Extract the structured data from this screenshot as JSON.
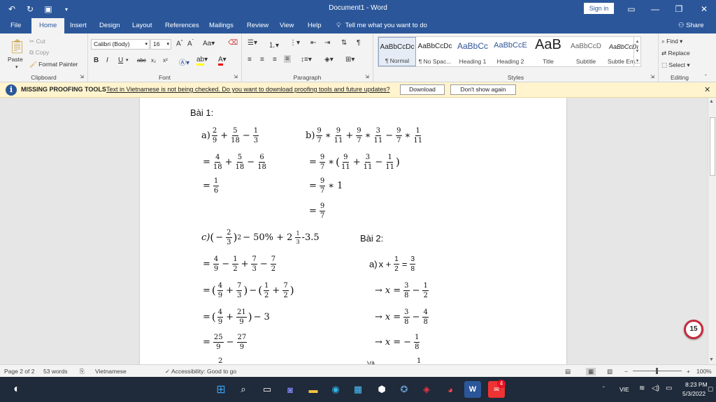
{
  "window": {
    "title": "Document1 - Word",
    "signin_label": "Sign in"
  },
  "menu": {
    "tabs": [
      "File",
      "Home",
      "Insert",
      "Design",
      "Layout",
      "References",
      "Mailings",
      "Review",
      "View",
      "Help"
    ],
    "active": "Home",
    "tell_me": "Tell me what you want to do",
    "share": "Share"
  },
  "ribbon": {
    "clipboard": {
      "label": "Clipboard",
      "paste": "Paste",
      "cut": "Cut",
      "copy": "Copy",
      "format_painter": "Format Painter"
    },
    "font": {
      "label": "Font",
      "name": "Calibri (Body)",
      "size": "16"
    },
    "paragraph": {
      "label": "Paragraph"
    },
    "styles": {
      "label": "Styles",
      "items": [
        {
          "preview": "AaBbCcDc",
          "name": "¶ Normal"
        },
        {
          "preview": "AaBbCcDc",
          "name": "¶ No Spac..."
        },
        {
          "preview": "AaBbCc",
          "name": "Heading 1"
        },
        {
          "preview": "AaBbCcE",
          "name": "Heading 2"
        },
        {
          "preview": "AaB",
          "name": "Title"
        },
        {
          "preview": "AaBbCcD",
          "name": "Subtitle"
        },
        {
          "preview": "AaBbCcDı",
          "name": "Subtle Em..."
        }
      ]
    },
    "editing": {
      "label": "Editing",
      "find": "Find",
      "replace": "Replace",
      "select": "Select"
    }
  },
  "notification": {
    "title": "MISSING PROOFING TOOLS",
    "message": "Text in Vietnamese is not being checked. Do you want to download proofing tools and future updates?",
    "download": "Download",
    "dismiss": "Don't show again"
  },
  "document": {
    "bai1": "Bài 1:",
    "bai2": "Bài 2:",
    "a_label": "a)",
    "b_label": "b)",
    "c_label": "c)",
    "bai2_a_label": "a)",
    "bai2_a_var": "x +",
    "ops": {
      "plus": "+",
      "minus": "−",
      "times": "∗",
      "eq": "=",
      "arrow": "→",
      "x": "x",
      "open": "(",
      "close": ")"
    },
    "nums": {
      "one": "1",
      "three": "3",
      "three_five": "− 50% + 2",
      "tail": "-3.5",
      "sq": "2",
      "two": "2"
    },
    "fr": {
      "f_2_9": [
        "2",
        "9"
      ],
      "f_5_18": [
        "5",
        "18"
      ],
      "f_1_3": [
        "1",
        "3"
      ],
      "f_4_18": [
        "4",
        "18"
      ],
      "f_6_18": [
        "6",
        "18"
      ],
      "f_1_6": [
        "1",
        "6"
      ],
      "f_9_7": [
        "9",
        "7"
      ],
      "f_9_11": [
        "9",
        "11"
      ],
      "f_3_11": [
        "3",
        "11"
      ],
      "f_1_11": [
        "1",
        "11"
      ],
      "f_2_3": [
        "2",
        "3"
      ],
      "f_1_3b": [
        "1",
        "3"
      ],
      "f_4_9": [
        "4",
        "9"
      ],
      "f_1_2": [
        "1",
        "2"
      ],
      "f_7_3": [
        "7",
        "3"
      ],
      "f_7_2": [
        "7",
        "2"
      ],
      "f_21_9": [
        "21",
        "9"
      ],
      "f_25_9": [
        "25",
        "9"
      ],
      "f_27_9": [
        "27",
        "9"
      ],
      "f_3_8": [
        "3",
        "8"
      ],
      "f_4_8": [
        "4",
        "8"
      ],
      "f_1_8": [
        "1",
        "8"
      ]
    },
    "bottom_partial_left": "2",
    "bottom_partial_right_1": "Vậ",
    "bottom_partial_right_2": "1"
  },
  "page_badge": "15",
  "status": {
    "page": "Page 2 of 2",
    "words": "53 words",
    "language": "Vietnamese",
    "accessibility": "Accessibility: Good to go",
    "zoom": "100%"
  },
  "taskbar": {
    "mail_badge": "4",
    "lang": "VIE",
    "time": "8:23 PM",
    "date": "5/3/2022"
  }
}
